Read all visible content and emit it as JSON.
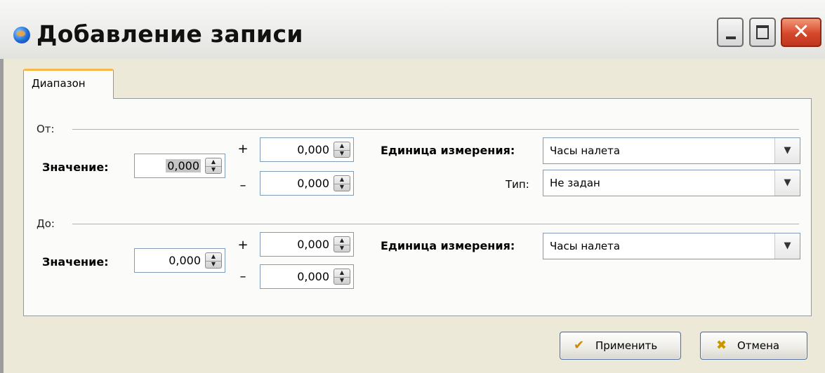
{
  "window": {
    "title": "Добавление записи",
    "close_glyph": "✕",
    "icons": {
      "app": "app-globe-icon",
      "minimize": "minimize-icon",
      "maximize": "maximize-icon",
      "close": "close-icon"
    }
  },
  "tabs": [
    {
      "label": "Диапазон",
      "selected": true
    }
  ],
  "from": {
    "group_label": "От:",
    "value_label": "Значение:",
    "value": "0,000",
    "plus_sign": "+",
    "plus_value": "0,000",
    "minus_sign": "–",
    "minus_value": "0,000",
    "unit_label": "Единица измерения:",
    "unit_value": "Часы налета",
    "type_label": "Тип:",
    "type_value": "Не задан"
  },
  "to": {
    "group_label": "До:",
    "value_label": "Значение:",
    "value": "0,000",
    "plus_sign": "+",
    "plus_value": "0,000",
    "minus_sign": "–",
    "minus_value": "0,000",
    "unit_label": "Единица измерения:",
    "unit_value": "Часы налета"
  },
  "spin_glyphs": {
    "up": "▲",
    "down": "▼"
  },
  "combo_arrow": "▼",
  "buttons": {
    "apply_label": "Применить",
    "apply_icon": "✔",
    "cancel_label": "Отмена",
    "cancel_icon": "✖"
  },
  "colors": {
    "accent_tab": "#f5b94a",
    "close_button": "#d6482a",
    "apply_check": "#d18a00",
    "cancel_x": "#c79500"
  }
}
